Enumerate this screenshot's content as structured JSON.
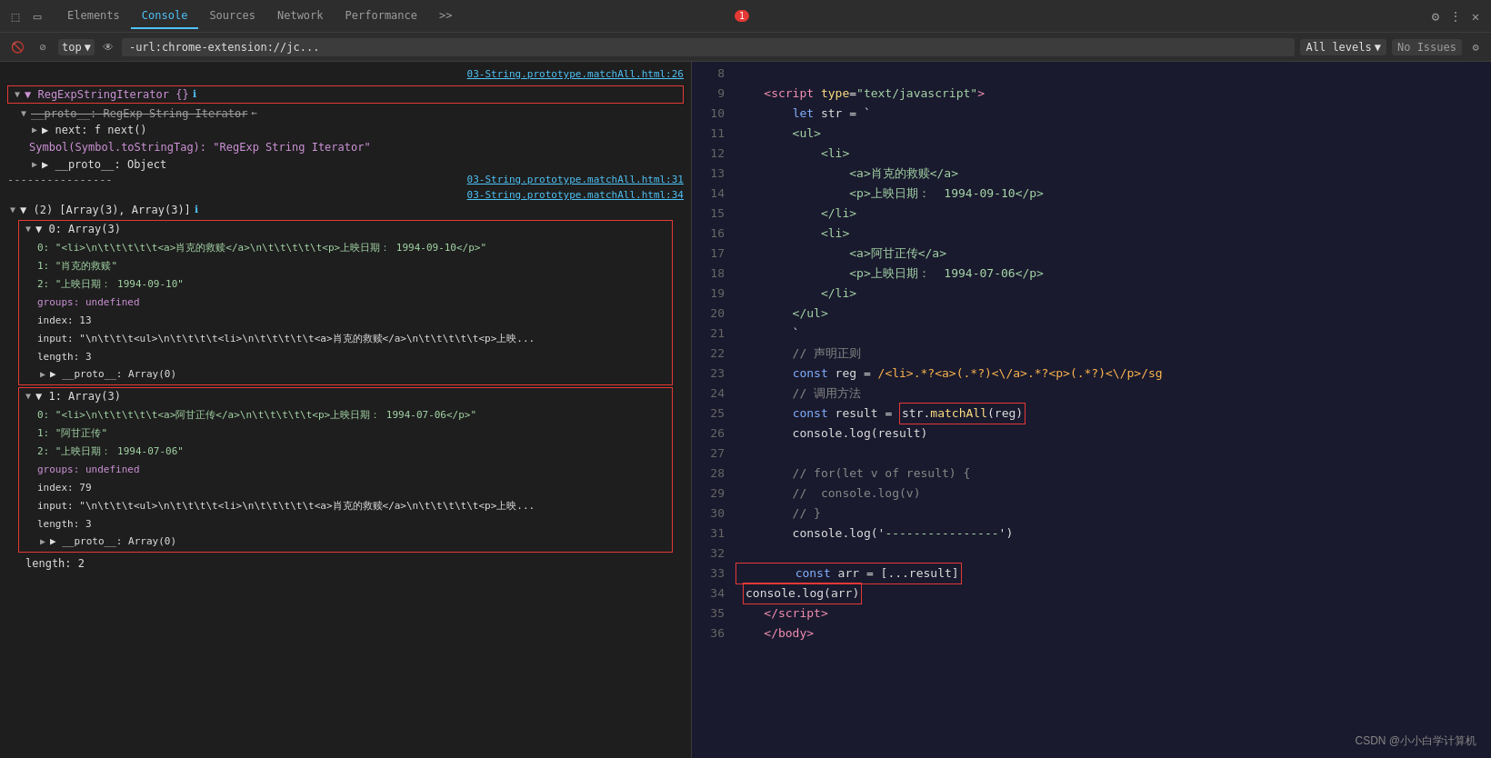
{
  "devtools": {
    "tabs": [
      "Elements",
      "Console",
      "Sources",
      "Network",
      "Performance",
      ">>"
    ],
    "active_tab": "Console",
    "badge_count": "1",
    "filter_bar": {
      "context": "top",
      "filter_placeholder": "-url:chrome-extension://jc...",
      "levels": "All levels",
      "no_issues": "No Issues"
    }
  },
  "console_output": {
    "file_link_1": "03-String.prototype.matchAll.html:26",
    "iterator_label": "▼ RegExpStringIterator {}",
    "proto_label": "▼ __proto__: RegExp String Iterator",
    "strikethrough_text": "__proto__: RegExp String Iterator",
    "next_label": "▶ next: f next()",
    "symbol_label": "Symbol(Symbol.toStringTag): \"RegExp String Iterator\"",
    "proto2_label": "▶ __proto__: Object",
    "separator": "----------------",
    "file_link_2": "03-String.prototype.matchAll.html:31",
    "file_link_3": "03-String.prototype.matchAll.html:34",
    "array_label": "▼ (2) [Array(3), Array(3)]",
    "item0_label": "▼ 0: Array(3)",
    "item0_0": "0: \"<li>\\n\\t\\t\\t\\t\\t<a>肖克的救赎</a>\\n\\t\\t\\t\\t\\t<p>上映日期：  1994-09-10</p>\"",
    "item0_1": "1: \"肖克的救赎\"",
    "item0_2": "2: \"上映日期：  1994-09-10\"",
    "groups_1": "groups: undefined",
    "index_1": "index: 13",
    "input_1": "input: \"\\n\\t\\t\\t<ul>\\n\\t\\t\\t\\t<li>\\n\\t\\t\\t\\t\\t<a>肖克的救赎</a>\\n\\t\\t\\t\\t\\t<p>上映...",
    "length_1": "length: 3",
    "proto3_label": "▶ __proto__: Array(0)",
    "item1_label": "▼ 1: Array(3)",
    "item1_0": "0: \"<li>\\n\\t\\t\\t\\t\\t<a>阿甘正传</a>\\n\\t\\t\\t\\t\\t<p>上映日期：  1994-07-06</p>\"",
    "item1_1": "1: \"阿甘正传\"",
    "item1_2": "2: \"上映日期：  1994-07-06\"",
    "groups_2": "groups: undefined",
    "index_2": "index: 79",
    "input_2": "input: \"\\n\\t\\t\\t<ul>\\n\\t\\t\\t\\t<li>\\n\\t\\t\\t\\t\\t<a>肖克的救赎</a>\\n\\t\\t\\t\\t\\t<p>上映...",
    "length_2": "length: 3",
    "proto4_label": "▶ __proto__: Array(0)",
    "total_length": "length: 2"
  },
  "code_lines": {
    "line8": "8",
    "line9": "9",
    "line10": "10",
    "line11": "11",
    "line12": "12",
    "line13": "13",
    "line14": "14",
    "line15": "15",
    "line16": "16",
    "line17": "17",
    "line18": "18",
    "line19": "19",
    "line20": "20",
    "line21": "21",
    "line22": "22",
    "line23": "23",
    "line24": "24",
    "line25": "25",
    "line26": "26",
    "line27": "27",
    "line28": "28",
    "line29": "29",
    "line30": "30",
    "line31": "31",
    "line32": "32",
    "line33": "33",
    "line34": "34",
    "line35": "35",
    "line36": "36"
  },
  "watermark": "CSDN @小小白学计算机"
}
